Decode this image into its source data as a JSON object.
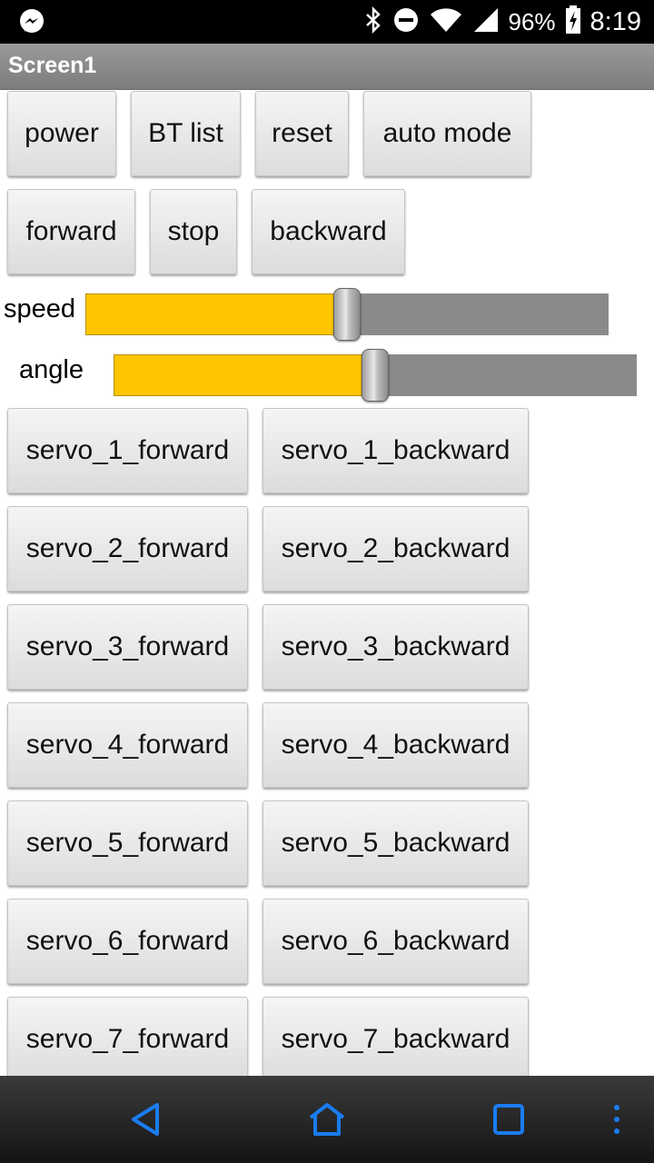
{
  "status_bar": {
    "left_icon": "messenger-icon",
    "icons": [
      "bluetooth-icon",
      "do-not-disturb-icon",
      "wifi-icon",
      "signal-icon"
    ],
    "battery_percent": "96%",
    "battery_icon": "battery-charging-icon",
    "time": "8:19"
  },
  "title_bar": {
    "title": "Screen1"
  },
  "row1": [
    "power",
    "BT list",
    "reset",
    "auto mode"
  ],
  "row2": [
    "forward",
    "stop",
    "backward"
  ],
  "sliders": {
    "speed": {
      "label": "speed",
      "value_fraction": 0.5,
      "fill_color": "#fec600",
      "track_color": "#8a8a8a"
    },
    "angle": {
      "label": "angle",
      "value_fraction": 0.5,
      "fill_color": "#fec600",
      "track_color": "#8a8a8a"
    }
  },
  "servos": [
    {
      "forward": "servo_1_forward",
      "backward": "servo_1_backward"
    },
    {
      "forward": "servo_2_forward",
      "backward": "servo_2_backward"
    },
    {
      "forward": "servo_3_forward",
      "backward": "servo_3_backward"
    },
    {
      "forward": "servo_4_forward",
      "backward": "servo_4_backward"
    },
    {
      "forward": "servo_5_forward",
      "backward": "servo_5_backward"
    },
    {
      "forward": "servo_6_forward",
      "backward": "servo_6_backward"
    },
    {
      "forward": "servo_7_forward",
      "backward": "servo_7_backward"
    }
  ],
  "nav_bar": {
    "icons": [
      "back-icon",
      "home-icon",
      "recents-icon",
      "menu-icon"
    ],
    "icon_color": "#1a7cf0"
  }
}
